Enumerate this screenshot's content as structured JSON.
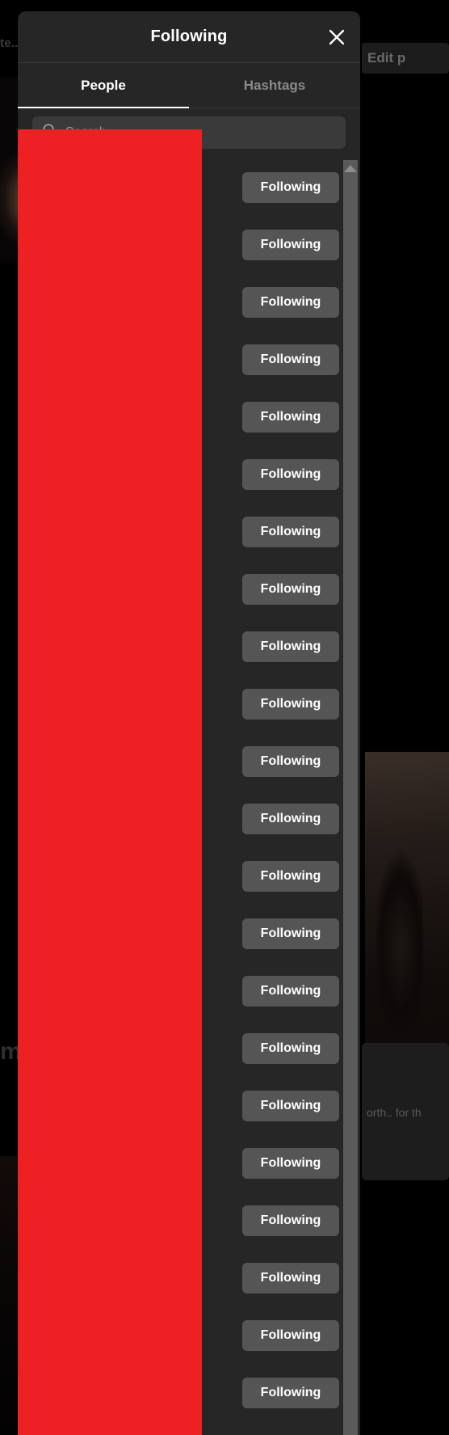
{
  "background": {
    "top_text": "te...",
    "edit_button_label": "Edit p",
    "card_left_text": "m\nn",
    "card_right_text": "orth.. for th"
  },
  "modal": {
    "title": "Following",
    "close_icon": "close-icon",
    "tabs": [
      {
        "label": "People",
        "active": true
      },
      {
        "label": "Hashtags",
        "active": false
      }
    ],
    "search": {
      "icon": "search-icon",
      "placeholder": "Search",
      "value": ""
    },
    "scrollbar": {
      "arrow_icon": "chevron-up-icon"
    },
    "list": {
      "follow_button_label": "Following",
      "rows": [
        {
          "handle": "",
          "name": "",
          "action": "Following"
        },
        {
          "handle": "",
          "name": "",
          "action": "Following"
        },
        {
          "handle": "",
          "name": "",
          "action": "Following"
        },
        {
          "handle": "",
          "name": "",
          "action": "Following"
        },
        {
          "handle": "",
          "name": "",
          "action": "Following"
        },
        {
          "handle": "",
          "name": "",
          "action": "Following"
        },
        {
          "handle": "",
          "name": "",
          "action": "Following"
        },
        {
          "handle": "",
          "name": "",
          "action": "Following"
        },
        {
          "handle": "",
          "name": "",
          "action": "Following"
        },
        {
          "handle": "",
          "name": "",
          "action": "Following"
        },
        {
          "handle": "",
          "name": "",
          "action": "Following"
        },
        {
          "handle": "",
          "name": "",
          "action": "Following"
        },
        {
          "handle": "",
          "name": "",
          "action": "Following"
        },
        {
          "handle": "",
          "name": "",
          "action": "Following"
        },
        {
          "handle": "",
          "name": "",
          "action": "Following"
        },
        {
          "handle": "",
          "name": "",
          "action": "Following"
        },
        {
          "handle": "",
          "name": "",
          "action": "Following"
        },
        {
          "handle": "",
          "name": "",
          "action": "Following"
        },
        {
          "handle": "",
          "name": "",
          "action": "Following"
        },
        {
          "handle": "",
          "name": "",
          "action": "Following"
        },
        {
          "handle": "",
          "name": "",
          "action": "Following"
        },
        {
          "handle": "",
          "name": "",
          "action": "Following"
        }
      ]
    }
  },
  "colors": {
    "modal_bg": "#262626",
    "button_bg": "#555555",
    "search_bg": "#3a3a3a",
    "redaction": "#ED2024",
    "scrollbar": "#5a5a5a"
  }
}
